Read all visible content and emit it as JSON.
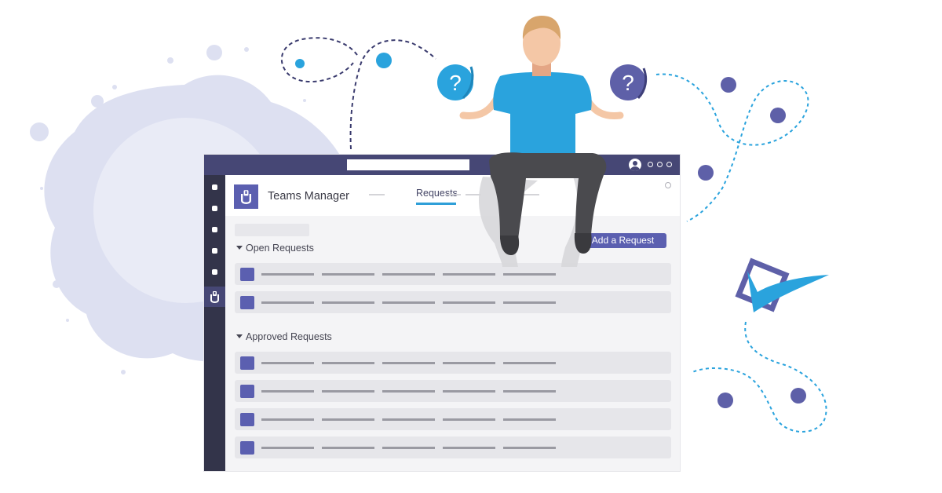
{
  "app": {
    "name": "Teams Manager",
    "active_tab": "Requests"
  },
  "actions": {
    "add_request": "Add a Request"
  },
  "sections": [
    {
      "title": "Open Requests",
      "row_count": 2
    },
    {
      "title": "Approved Requests",
      "row_count": 4
    }
  ],
  "colors": {
    "titlebar": "#464775",
    "rail": "#33344a",
    "accent": "#5b5fb0",
    "tab_underline": "#2f9fd8",
    "illustration_blue": "#2aa3dd",
    "illustration_purple": "#5e60a8",
    "blob": "#dcdff0"
  },
  "icons": {
    "rail_active": "teams-manager-icon",
    "help_left": "question-bubble-icon",
    "help_right": "question-bubble-icon",
    "approval": "checkmark-box-icon"
  }
}
